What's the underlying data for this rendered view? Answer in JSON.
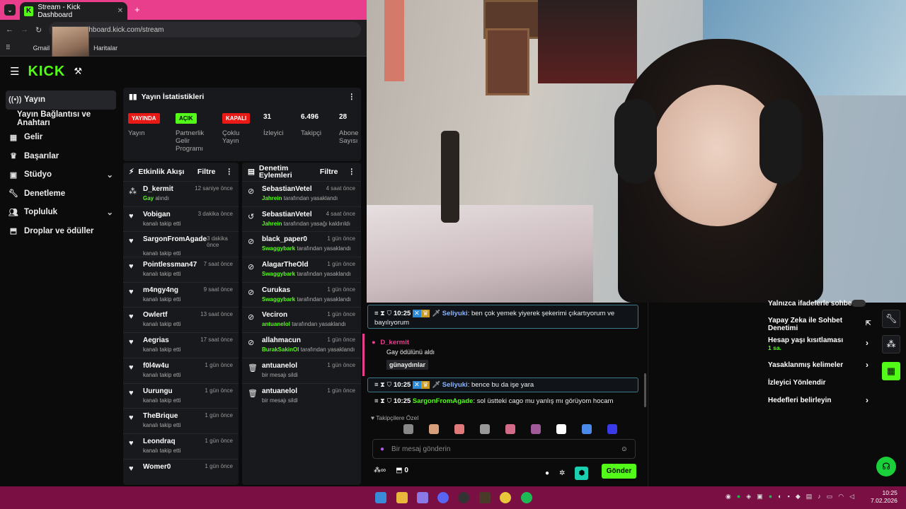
{
  "browser": {
    "tab_title": "Stream - Kick Dashboard",
    "url": "dashboard.kick.com/stream",
    "bookmarks": [
      "Gmail",
      "Haritalar"
    ]
  },
  "brand": {
    "name": "KICK",
    "accent": "#53fc18"
  },
  "sidebar": {
    "items": [
      {
        "label": "Yayın",
        "icon": "broadcast-icon"
      },
      {
        "label": "Yayın Bağlantısı ve Anahtarı",
        "icon": ""
      },
      {
        "label": "Gelir",
        "icon": "money-icon"
      },
      {
        "label": "Başarılar",
        "icon": "trophy-icon"
      },
      {
        "label": "Stüdyo",
        "icon": "studio-icon"
      },
      {
        "label": "Denetleme",
        "icon": "wrench-icon"
      },
      {
        "label": "Topluluk",
        "icon": "users-icon"
      },
      {
        "label": "Droplar ve ödüller",
        "icon": "gift-icon"
      }
    ]
  },
  "stats": {
    "title": "Yayın İstatistikleri",
    "items": [
      {
        "badge": "YAYINDA",
        "label": "Yayın"
      },
      {
        "badge": "AÇIK",
        "label": "Partnerlik Gelir Programı"
      },
      {
        "badge": "KAPALI",
        "label": "Çoklu Yayın"
      },
      {
        "value": "31",
        "label": "İzleyici"
      },
      {
        "value": "6.496",
        "label": "Takipçi"
      },
      {
        "value": "28",
        "label": "Abone Sayısı"
      }
    ]
  },
  "events": {
    "title": "Etkinlik Akışı",
    "filter": "Filtre",
    "rows": [
      {
        "name": "D_kermit",
        "time": "12 saniye önce",
        "sub_hl": "Gay",
        "sub": "alındı"
      },
      {
        "name": "Vobigan",
        "time": "3 dakika önce",
        "sub": "kanalı takip etti"
      },
      {
        "name": "SargonFromAgade",
        "time": "3 dakika önce",
        "sub": "kanalı takip etti"
      },
      {
        "name": "Pointlessman47",
        "time": "7 saat önce",
        "sub": "kanalı takip etti"
      },
      {
        "name": "m4ngy4ng",
        "time": "9 saat önce",
        "sub": "kanalı takip etti"
      },
      {
        "name": "Owlertf",
        "time": "13 saat önce",
        "sub": "kanalı takip etti"
      },
      {
        "name": "Aegrias",
        "time": "17 saat önce",
        "sub": "kanalı takip etti"
      },
      {
        "name": "f0l4w4u",
        "time": "1 gün önce",
        "sub": "kanalı takip etti"
      },
      {
        "name": "Uurungu",
        "time": "1 gün önce",
        "sub": "kanalı takip etti"
      },
      {
        "name": "TheBrique",
        "time": "1 gün önce",
        "sub": "kanalı takip etti"
      },
      {
        "name": "Leondraq",
        "time": "1 gün önce",
        "sub": "kanalı takip etti"
      },
      {
        "name": "Womer0",
        "time": "1 gün önce",
        "sub": ""
      }
    ]
  },
  "mod": {
    "title": "Denetim Eylemleri",
    "filter": "Filtre",
    "rows": [
      {
        "name": "SebastianVetel",
        "time": "4 saat önce",
        "sub_hl": "Jahrein",
        "sub": "tarafından yasaklandı"
      },
      {
        "name": "SebastianVetel",
        "time": "4 saat önce",
        "sub_hl": "Jahrein",
        "sub": "tarafından yasağı kaldırıldı"
      },
      {
        "name": "black_paper0",
        "time": "1 gün önce",
        "sub_hl": "Swaggybark",
        "sub": "tarafından yasaklandı"
      },
      {
        "name": "AlagarTheOld",
        "time": "1 gün önce",
        "sub_hl": "Swaggybark",
        "sub": "tarafından yasaklandı"
      },
      {
        "name": "Curukas",
        "time": "1 gün önce",
        "sub_hl": "Swaggybark",
        "sub": "tarafından yasaklandı"
      },
      {
        "name": "Veciron",
        "time": "1 gün önce",
        "sub_hl": "antuanelol",
        "sub": "tarafından yasaklandı"
      },
      {
        "name": "allahmacun",
        "time": "1 gün önce",
        "sub_hl": "BurakSakinOl",
        "sub": "tarafından yasaklandı"
      },
      {
        "name": "antuanelol",
        "time": "1 gün önce",
        "sub": "bir mesajı sildi"
      },
      {
        "name": "antuanelol",
        "time": "1 gün önce",
        "sub": "bir mesajı sildi"
      }
    ]
  },
  "chat": {
    "messages": [
      {
        "time": "10:25",
        "user": "Seliyuki",
        "text": "ben çok yemek yiyerek şekerimi çıkartıyorum ve bayılıyorum"
      },
      {
        "event_user": "D_kermit",
        "event_text": "Gay ödülünü aldı",
        "event_reply": "günaydınlar"
      },
      {
        "time": "10:25",
        "user": "Seliyuki",
        "text": "bence bu da işe yara"
      },
      {
        "time": "10:25",
        "user": "SargonFromAgade",
        "text": "sol üstteki cago mu yanlış mı görüyom hocam"
      }
    ],
    "followers_only": "Takipçilere Özel",
    "placeholder": "Bir mesaj gönderin",
    "points": "0",
    "send_label": "Gönder"
  },
  "right_panel": {
    "items": [
      {
        "label": "Yalnızca ifadelerle sohbet"
      },
      {
        "label": "Yapay Zeka ile Sohbet Denetimi"
      },
      {
        "label": "Hesap yaşı kısıtlaması",
        "sub": "1 sa."
      },
      {
        "label": "Yasaklanmış kelimeler"
      },
      {
        "label": "İzleyici Yönlendir"
      },
      {
        "label": "Hedefleri belirleyin"
      }
    ]
  },
  "taskbar": {
    "time": "10:25",
    "date": "7.02.2026"
  }
}
